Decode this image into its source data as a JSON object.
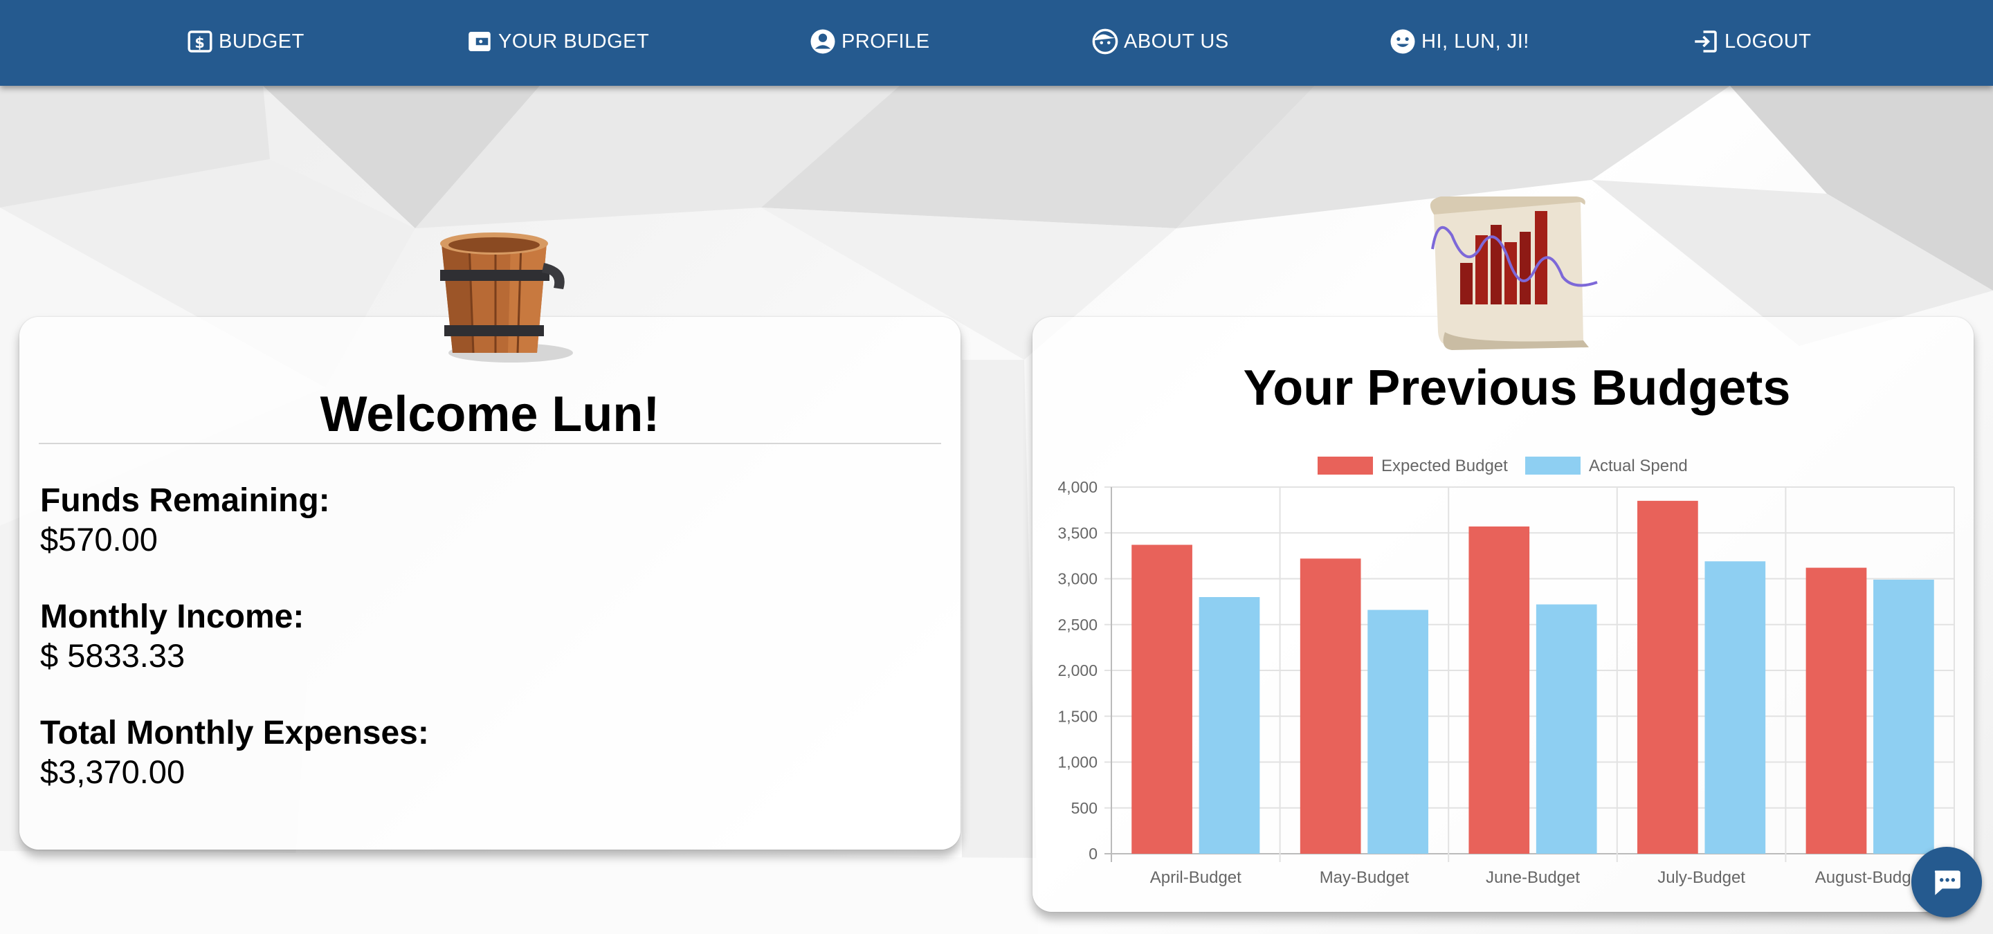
{
  "nav": {
    "items": [
      {
        "label": "BUDGET",
        "icon": "dollar-bill-icon"
      },
      {
        "label": "YOUR BUDGET",
        "icon": "wallet-icon"
      },
      {
        "label": "PROFILE",
        "icon": "account-circle-icon"
      },
      {
        "label": "ABOUT US",
        "icon": "face-icon"
      },
      {
        "label": "HI, LUN, JI!",
        "icon": "smiley-icon"
      },
      {
        "label": "LOGOUT",
        "icon": "logout-icon"
      }
    ]
  },
  "welcome": {
    "title": "Welcome Lun!",
    "funds_label": "Funds Remaining:",
    "funds_value": "$570.00",
    "income_label": "Monthly Income:",
    "income_value": "$ 5833.33",
    "expenses_label": "Total Monthly Expenses:",
    "expenses_value": "$3,370.00"
  },
  "previous": {
    "title": "Your Previous Budgets"
  },
  "colors": {
    "nav": "#255a8f",
    "expected": "#e8625a",
    "actual": "#8ecff2"
  },
  "chart_data": {
    "type": "bar",
    "categories": [
      "April-Budget",
      "May-Budget",
      "June-Budget",
      "July-Budget",
      "August-Budget"
    ],
    "series": [
      {
        "name": "Expected Budget",
        "values": [
          3370,
          3220,
          3570,
          3850,
          3120
        ]
      },
      {
        "name": "Actual Spend",
        "values": [
          2800,
          2660,
          2720,
          3190,
          2990
        ]
      }
    ],
    "ylim": [
      0,
      4000
    ],
    "yticks": [
      "0",
      "500",
      "1,000",
      "1,500",
      "2,000",
      "2,500",
      "3,000",
      "3,500",
      "4,000"
    ],
    "grid": true,
    "legend": "top-center"
  },
  "chat": {
    "icon": "chat-bubble-icon"
  }
}
